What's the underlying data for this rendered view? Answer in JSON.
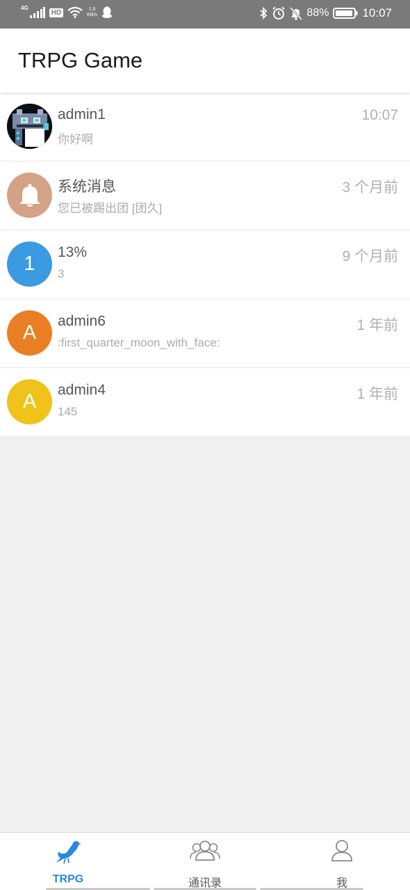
{
  "status_bar": {
    "network": "4G",
    "hd": "HD",
    "speed_value": "1.6",
    "speed_unit": "KB/s",
    "battery": "88%",
    "time": "10:07"
  },
  "header": {
    "title": "TRPG Game"
  },
  "conversations": [
    {
      "name": "admin1",
      "message": "你好啊",
      "time": "10:07",
      "avatar_type": "image"
    },
    {
      "name": "系统消息",
      "message": "您已被踢出团 [团久]",
      "time": "3 个月前",
      "avatar_type": "bell-icon",
      "avatar_color": "#d4a286"
    },
    {
      "name": "13%",
      "message": "3",
      "time": "9 个月前",
      "avatar_letter": "1",
      "avatar_color": "#3b9ae1"
    },
    {
      "name": "admin6",
      "message": ":first_quarter_moon_with_face:",
      "time": "1 年前",
      "avatar_letter": "A",
      "avatar_color": "#e97f22"
    },
    {
      "name": "admin4",
      "message": "145",
      "time": "1 年前",
      "avatar_letter": "A",
      "avatar_color": "#f0c31a"
    }
  ],
  "bottom_nav": {
    "tabs": [
      {
        "label": "TRPG",
        "icon": "pigeon-icon",
        "active": true
      },
      {
        "label": "通讯录",
        "icon": "contacts-icon",
        "active": false
      },
      {
        "label": "我",
        "icon": "person-icon",
        "active": false
      }
    ]
  },
  "colors": {
    "accent": "#2b86e0",
    "status_bar": "#7a7a7a",
    "background": "#f0f0f0"
  }
}
